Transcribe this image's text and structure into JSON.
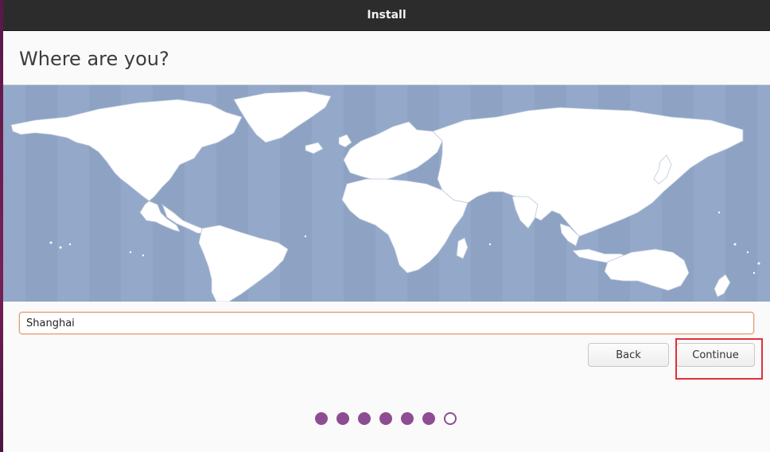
{
  "window": {
    "title": "Install"
  },
  "page": {
    "heading": "Where are you?"
  },
  "timezone": {
    "value": "Shanghai",
    "placeholder": ""
  },
  "buttons": {
    "back_label": "Back",
    "continue_label": "Continue"
  },
  "progress": {
    "total_steps": 7,
    "completed_steps": 6,
    "current_step": 7
  },
  "colors": {
    "accent": "#8e4d92",
    "map_ocean": "#94a9c9",
    "land": "#ffffff",
    "highlight": "#e0303a",
    "input_focus": "#e79a6f",
    "titlebar": "#2c2c2c"
  }
}
